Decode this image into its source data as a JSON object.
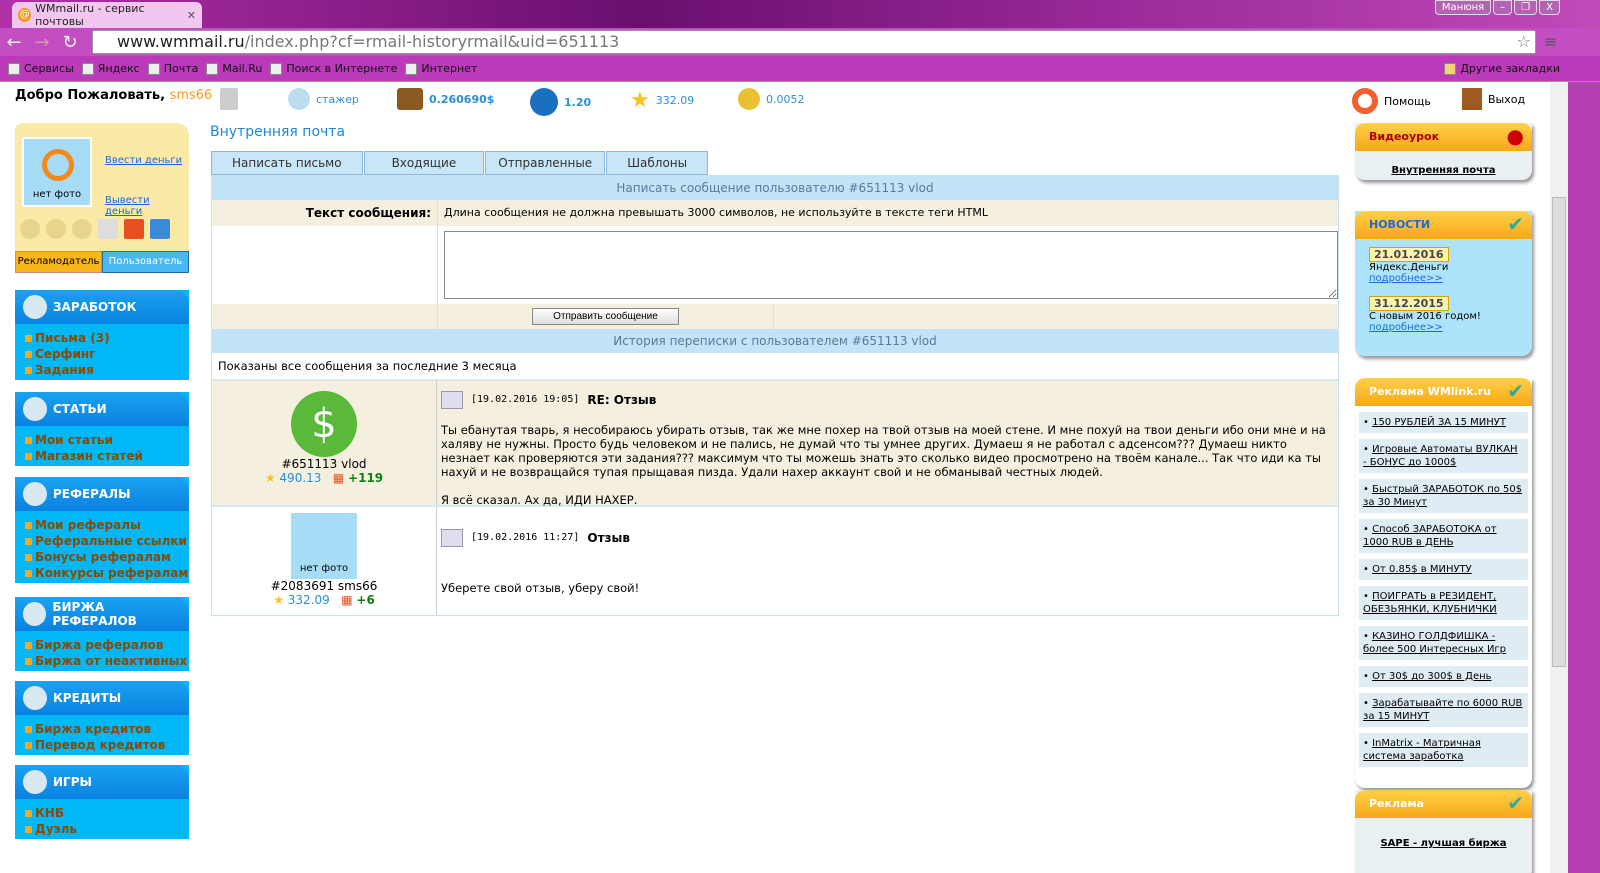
{
  "browser": {
    "tab_title": "WMmail.ru - сервис почтовы",
    "user": "Манюня",
    "url_host": "www.wmmail.ru",
    "url_path": "/index.php?cf=rmail-historyrmail&uid=651113",
    "bookmarks": [
      "Сервисы",
      "Яндекс",
      "Почта",
      "Mail.Ru",
      "Поиск в Интернете",
      "Интернет"
    ],
    "other_bookmarks": "Другие закладки"
  },
  "topbar": {
    "welcome": "Добро Пожаловать,",
    "username": "sms66",
    "status": "стажер",
    "balance": "0.260690$",
    "credits": "1.20",
    "rating": "332.09",
    "coins": "0.0052",
    "help": "Помощь",
    "exit": "Выход"
  },
  "profile": {
    "no_photo": "нет фото",
    "deposit": "Ввести деньги",
    "withdraw": "Вывести деньги",
    "role_advertiser": "Рекламодатель",
    "role_user": "Пользователь"
  },
  "menu": [
    {
      "title": "ЗАРАБОТОК",
      "items": [
        "Письма (3)",
        "Серфинг",
        "Задания"
      ]
    },
    {
      "title": "СТАТЬИ",
      "items": [
        "Мои статьи",
        "Магазин статей"
      ]
    },
    {
      "title": "РЕФЕРАЛЫ",
      "items": [
        "Мои рефералы",
        "Реферальные ссылки",
        "Бонусы рефералам",
        "Конкурсы рефералам"
      ]
    },
    {
      "title": "БИРЖА РЕФЕРАЛОВ",
      "items": [
        "Биржа рефералов",
        "Биржа от неактивных"
      ]
    },
    {
      "title": "КРЕДИТЫ",
      "items": [
        "Биржа кредитов",
        "Перевод кредитов"
      ]
    },
    {
      "title": "ИГРЫ",
      "items": [
        "КНБ",
        "Дуэль"
      ]
    }
  ],
  "main": {
    "title": "Внутренняя почта",
    "tabs": [
      "Написать письмо",
      "Входящие",
      "Отправленные",
      "Шаблоны"
    ],
    "compose_header": "Написать сообщение пользователю #651113 vlod",
    "text_label": "Текст сообщения:",
    "text_hint": "Длина сообщения не должна превышать 3000 символов, не используйте в тексте теги HTML",
    "message_value": "",
    "send": "Отправить сообщение",
    "history_header": "История переписки с пользователем #651113 vlod",
    "history_note": "Показаны все сообщения за последние 3 месяца",
    "messages": [
      {
        "user": "#651113 vlod",
        "rating": "490.13",
        "bonus": "+119",
        "date": "[19.02.2016 19:05]",
        "subject": "RE: Отзыв",
        "text": "Ты ебанутая тварь, я несобираюсь убирать отзыв, так же мне похер на твой отзыв на моей стене. И мне похуй на твои деньги ибо они мне и на халяву не нужны. Просто будь человеком и не пались, не думай что ты умнее других. Думаеш я не работал с адсенсом??? Думаеш никто незнает как проверяются эти задания??? максимум что ты можешь знать это сколько видео просмотрено на твоём канале... Так что иди ка ты нахуй и не возвращайся тупая прыщавая пизда. Удали нахер аккаунт свой и не обманывай честных людей.",
        "text2": "Я всё сказал. Ах да, ИДИ НАХЕР."
      },
      {
        "user": "#2083691 sms66",
        "no_photo": "нет фото",
        "rating": "332.09",
        "bonus": "+6",
        "date": "[19.02.2016 11:27]",
        "subject": "Отзыв",
        "text": "Уберете свой отзыв, уберу свой!",
        "text2": ""
      }
    ]
  },
  "right": {
    "video_title": "Видеоурок",
    "video_link": "Внутренняя почта",
    "news_title": "НОВОСТИ",
    "news": [
      {
        "date": "21.01.2016",
        "text": "Яндекс.Деньги",
        "more": "подробнее>>"
      },
      {
        "date": "31.12.2015",
        "text": "С новым 2016 годом!",
        "more": "подробнее>>"
      }
    ],
    "ads_title": "Реклама WMlink.ru",
    "ads": [
      "150 РУБЛЕЙ ЗА 15 МИНУТ",
      "Игровые Автоматы ВУЛКАН - БОНУС до 1000$",
      "Быстрый ЗАРАБОТОК по 50$ за 30 Минут",
      "Способ ЗАРАБОТОКА от 1000 RUB в ДЕНЬ",
      "От 0.85$ в МИНУТУ",
      "ПОИГРАТЬ в РЕЗИДЕНТ, ОБЕЗЬЯНКИ, КЛУБНИЧКИ",
      "КАЗИНО ГОЛДФИШКА - более 500 Интересных Игр",
      "От 30$ до 300$ в День",
      "Зарабатывайте по 6000 RUB за 15 МИНУТ",
      "InMatrix - Матричная система заработка"
    ],
    "ads2_title": "Реклама",
    "ads2_link": "SAPE - лучшая биржа"
  }
}
